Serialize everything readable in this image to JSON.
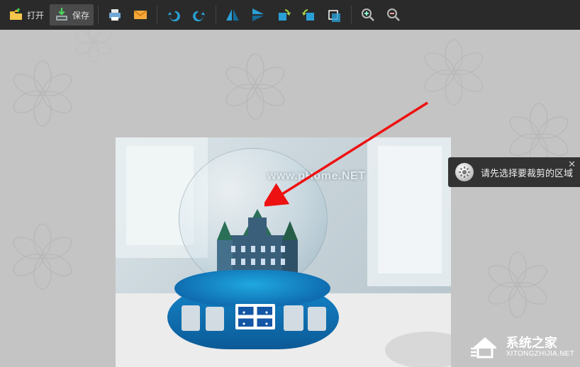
{
  "toolbar": {
    "open_label": "打开",
    "save_label": "保存"
  },
  "icons": {
    "open": "open-folder-icon",
    "save": "save-download-icon",
    "print": "printer-icon",
    "email": "email-icon",
    "undo": "undo-icon",
    "redo": "redo-icon",
    "flip_h": "flip-horizontal-icon",
    "flip_v": "flip-vertical-icon",
    "rotate_l": "rotate-left-icon",
    "rotate_r": "rotate-right-icon",
    "crop": "crop-icon",
    "zoom_in": "zoom-in-icon",
    "zoom_out": "zoom-out-icon",
    "gear": "gear-icon",
    "close": "close-icon"
  },
  "tooltip": {
    "text": "请先选择要裁剪的区域"
  },
  "image": {
    "center_watermark": "www.pHome.NET"
  },
  "brand": {
    "cn": "系统之家",
    "en": "XITONGZHIJIA.NET"
  },
  "colors": {
    "toolbar_bg": "#2a2a2a",
    "accent_blue": "#2a9fd6",
    "arrow_red": "#e11"
  }
}
